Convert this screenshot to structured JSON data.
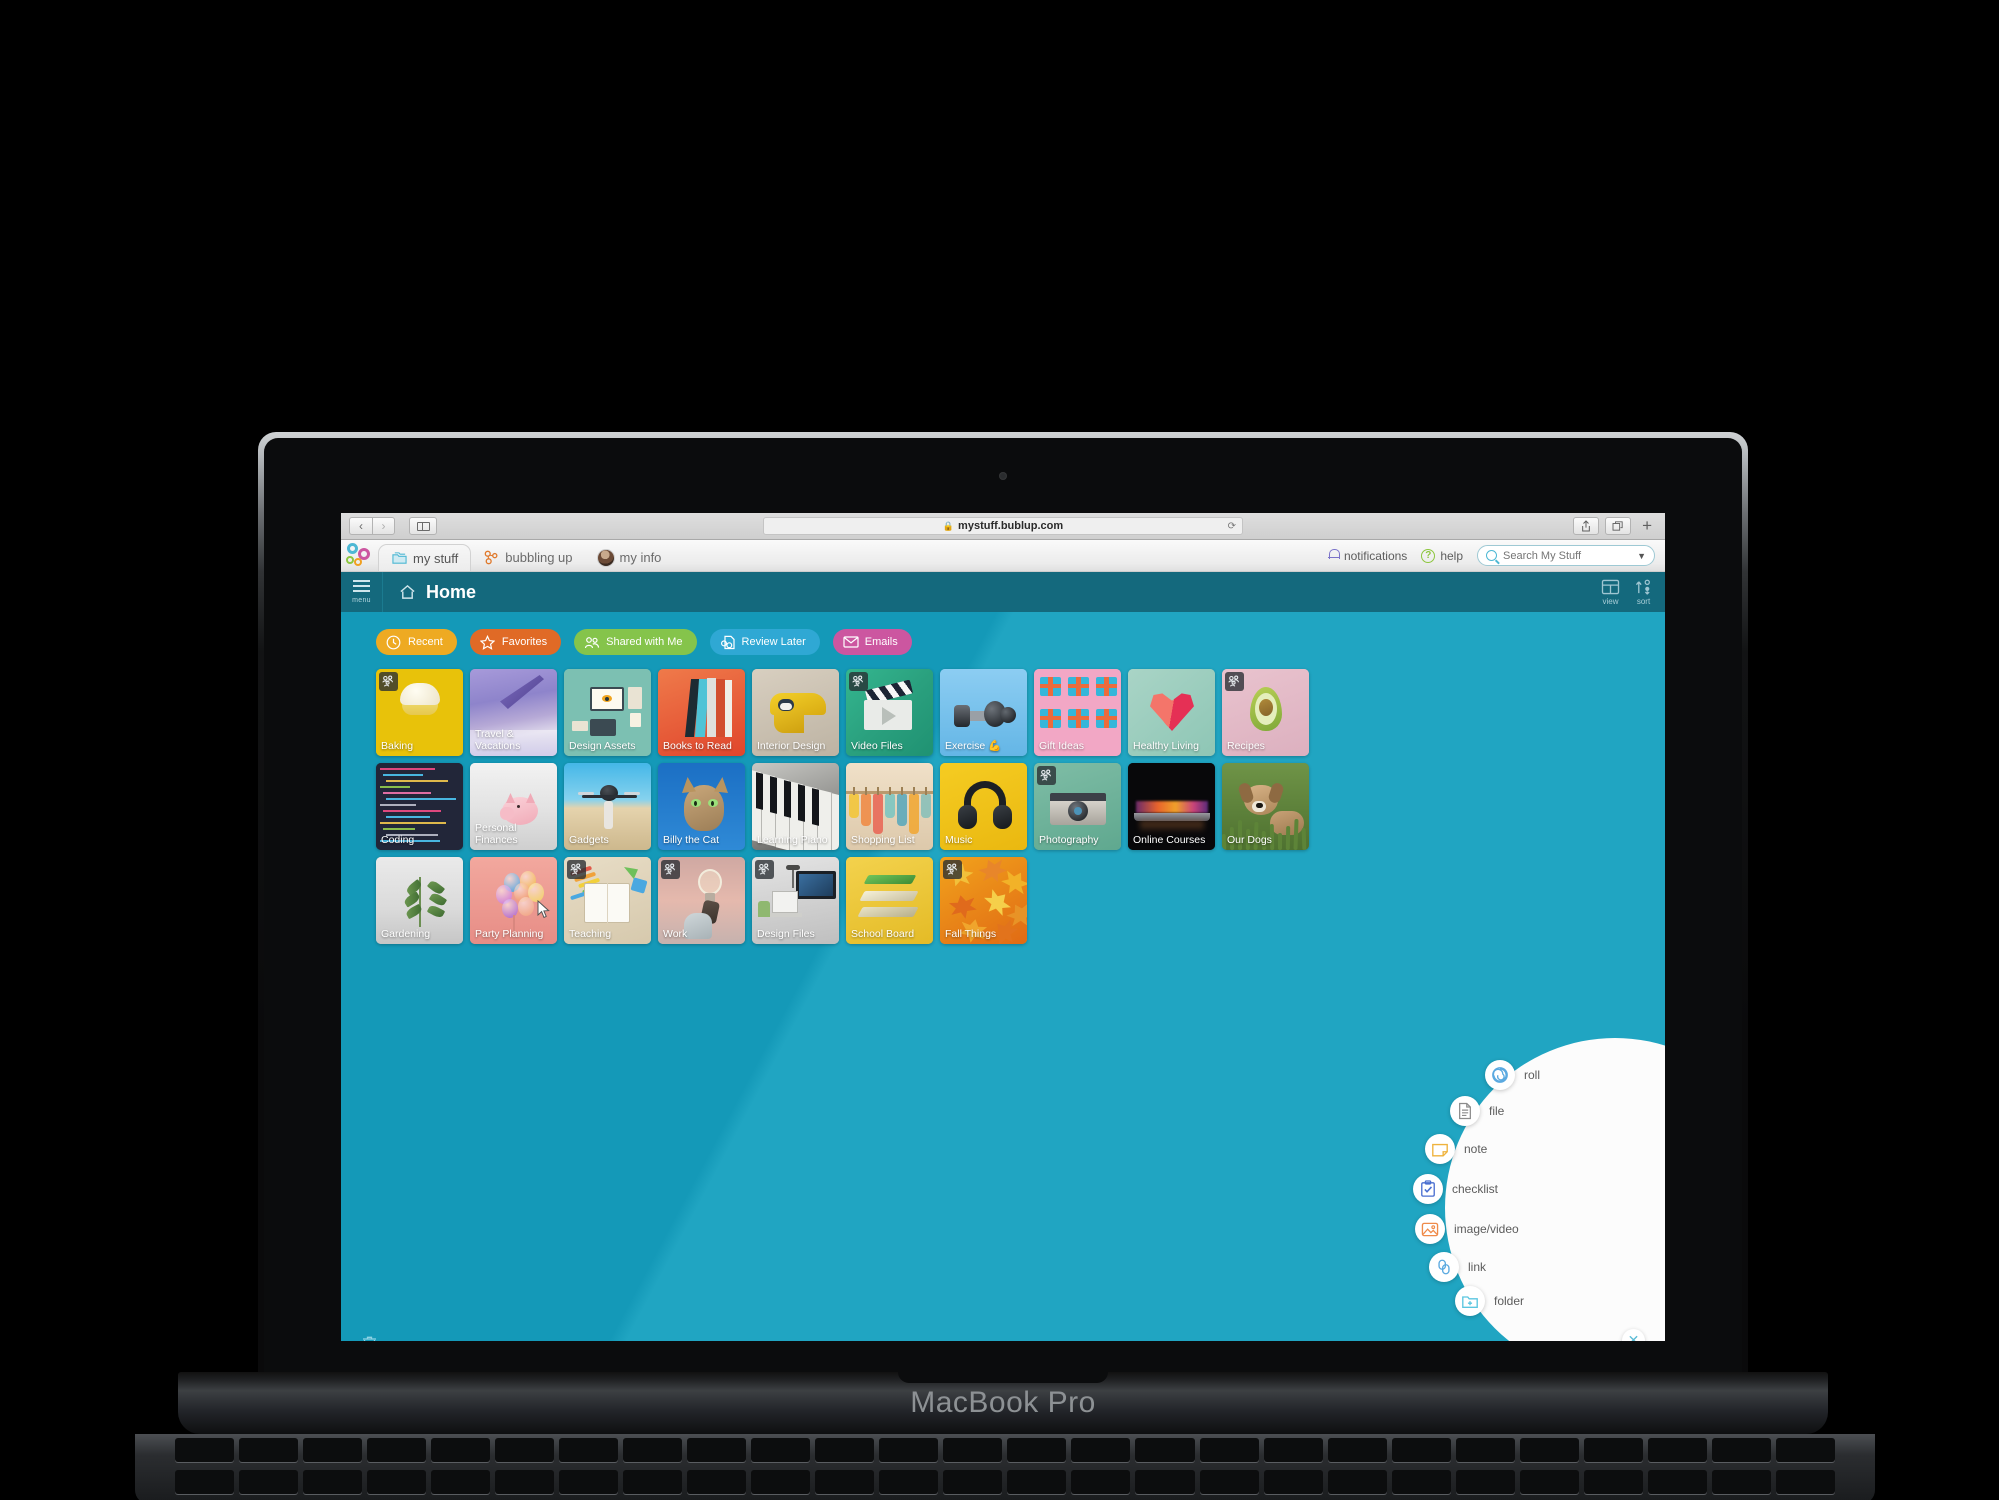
{
  "device": {
    "label": "MacBook Pro"
  },
  "browser": {
    "back_icon": "‹",
    "forward_icon": "›",
    "url": "mystuff.bublup.com",
    "lock_icon": "🔒",
    "reload_icon": "⟳",
    "share_icon": "⇧",
    "tabs_icon": "❐",
    "new_tab_icon": "+"
  },
  "app_tabs": [
    {
      "label": "my stuff",
      "icon": "folders-icon",
      "active": true
    },
    {
      "label": "bubbling up",
      "icon": "bubbles-icon",
      "active": false
    },
    {
      "label": "my info",
      "icon": "avatar-icon",
      "active": false
    }
  ],
  "top_right": {
    "notifications": "notifications",
    "help": "help",
    "search_placeholder": "Search My Stuff",
    "search_value": ""
  },
  "nav": {
    "menu_label": "menu",
    "title": "Home",
    "view_label": "view",
    "sort_label": "sort"
  },
  "filters": [
    {
      "label": "Recent",
      "color": "#eeaa22",
      "icon": "clock-icon"
    },
    {
      "label": "Favorites",
      "color": "#e06a26",
      "icon": "star-icon"
    },
    {
      "label": "Shared with Me",
      "color": "#85c44b",
      "icon": "people-icon"
    },
    {
      "label": "Review Later",
      "color": "#2fa8d4",
      "icon": "docs-icon"
    },
    {
      "label": "Emails",
      "color": "#cc56a0",
      "icon": "envelope-icon"
    }
  ],
  "folders": [
    [
      {
        "label": "Baking",
        "shared": true,
        "bg": "#e8c20a",
        "art": "cupcake"
      },
      {
        "label": "Travel &\nVacations",
        "shared": false,
        "bg": "#8e7fd0",
        "art": "plane"
      },
      {
        "label": "Design Assets",
        "shared": false,
        "bg": "#7cc0b2",
        "art": "desk"
      },
      {
        "label": "Books to Read",
        "shared": false,
        "bg": "#e8613a",
        "art": "books"
      },
      {
        "label": "Interior Design",
        "shared": false,
        "bg": "#cdbfa8",
        "art": "chair"
      },
      {
        "label": "Video Files",
        "shared": true,
        "bg": "#2fa984",
        "art": "clapper"
      },
      {
        "label": "Exercise 💪",
        "shared": false,
        "bg": "#73c3ef",
        "art": "dumbbell"
      },
      {
        "label": "Gift Ideas",
        "shared": false,
        "bg": "#ef9ec0",
        "art": "gifts"
      },
      {
        "label": "Healthy Living",
        "shared": false,
        "bg": "#9fcfc1",
        "art": "heart"
      },
      {
        "label": "Recipes",
        "shared": true,
        "bg": "#e2b9c6",
        "art": "avocado"
      }
    ],
    [
      {
        "label": "Coding",
        "shared": false,
        "bg": "#242739",
        "art": "code"
      },
      {
        "label": "Personal\nFinances",
        "shared": false,
        "bg": "#d9dadb",
        "art": "piggy"
      },
      {
        "label": "Gadgets",
        "shared": false,
        "bg": "#4fb6e0",
        "art": "drone"
      },
      {
        "label": "Billy the Cat",
        "shared": false,
        "bg": "#1b6fc4",
        "art": "cat"
      },
      {
        "label": "Learning Piano",
        "shared": false,
        "bg": "#9a9a9a",
        "art": "piano"
      },
      {
        "label": "Shopping List",
        "shared": false,
        "bg": "#e8c8a8",
        "art": "clothes"
      },
      {
        "label": "Music",
        "shared": false,
        "bg": "#f0c419",
        "art": "headphones"
      },
      {
        "label": "Photography",
        "shared": true,
        "bg": "#6fb39b",
        "art": "camera"
      },
      {
        "label": "Online Courses",
        "shared": false,
        "bg": "#111111",
        "art": "laptop"
      },
      {
        "label": "Our Dogs",
        "shared": false,
        "bg": "#6c8f45",
        "art": "dog"
      }
    ],
    [
      {
        "label": "Gardening",
        "shared": false,
        "bg": "#dcdcdc",
        "art": "plant"
      },
      {
        "label": "Party Planning",
        "shared": false,
        "bg": "#ef9d96",
        "art": "balloons"
      },
      {
        "label": "Teaching",
        "shared": true,
        "bg": "#e2d9c6",
        "art": "notebook"
      },
      {
        "label": "Work",
        "shared": true,
        "bg": "#d7b6ab",
        "art": "bulb"
      },
      {
        "label": "Design Files",
        "shared": true,
        "bg": "#cfcfcf",
        "art": "workspace"
      },
      {
        "label": "School Board",
        "shared": false,
        "bg": "#efcd44",
        "art": "shelves"
      },
      {
        "label": "Fall Things",
        "shared": true,
        "bg": "#f09a1e",
        "art": "leaves"
      }
    ]
  ],
  "fab": [
    {
      "label": "roll",
      "icon": "spiral-icon",
      "color": "#5aa9e0"
    },
    {
      "label": "file",
      "icon": "document-icon",
      "color": "#8b8b8b"
    },
    {
      "label": "note",
      "icon": "note-icon",
      "color": "#efb33d"
    },
    {
      "label": "checklist",
      "icon": "clipboard-icon",
      "color": "#4a6fd0"
    },
    {
      "label": "image/video",
      "icon": "image-icon",
      "color": "#ef8b4a"
    },
    {
      "label": "link",
      "icon": "link-icon",
      "color": "#5aa9e0"
    },
    {
      "label": "folder",
      "icon": "folder-add-icon",
      "color": "#5bc6e0"
    }
  ],
  "fab_close_icon": "✕",
  "trash_icon": "trash-icon",
  "colors": {
    "teal_nav": "#14697d",
    "canvas": "#1fa4c1",
    "accent": "#4db8d4"
  }
}
